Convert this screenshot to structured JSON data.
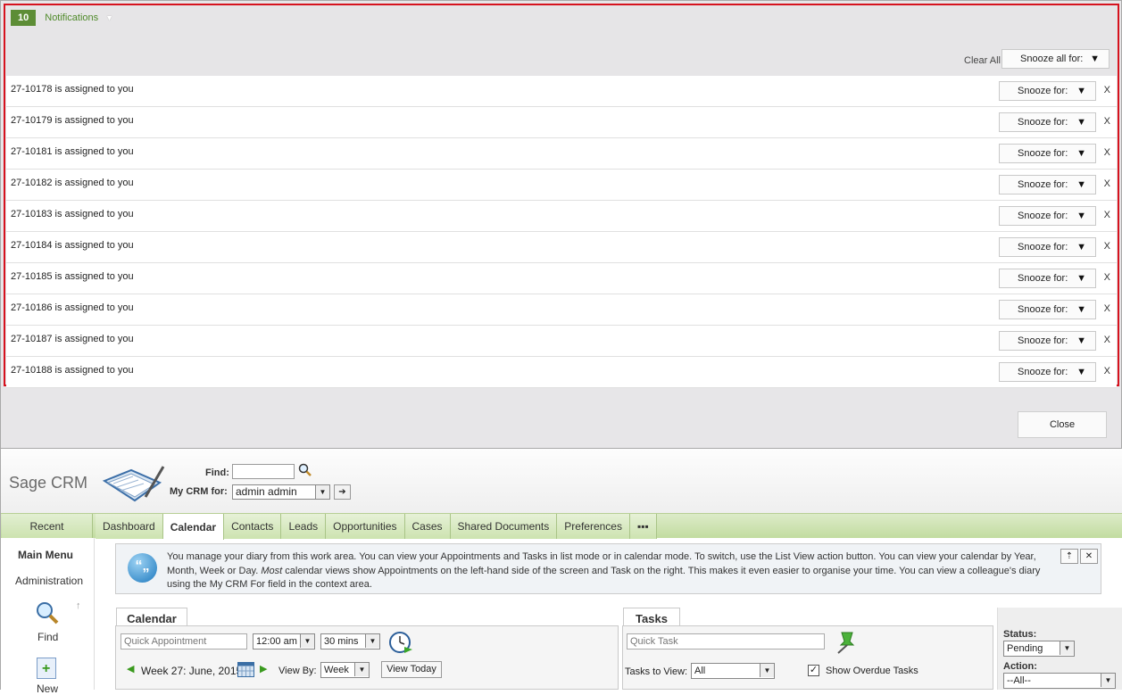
{
  "notifications": {
    "count": "10",
    "title": "Notifications",
    "clear_all": "Clear All",
    "snooze_all": "Snooze all for:",
    "items": [
      {
        "text": "27-10178 is assigned to you",
        "snooze": "Snooze for:",
        "close": "X"
      },
      {
        "text": "27-10179 is assigned to you",
        "snooze": "Snooze for:",
        "close": "X"
      },
      {
        "text": "27-10181 is assigned to you",
        "snooze": "Snooze for:",
        "close": "X"
      },
      {
        "text": "27-10182 is assigned to you",
        "snooze": "Snooze for:",
        "close": "X"
      },
      {
        "text": "27-10183 is assigned to you",
        "snooze": "Snooze for:",
        "close": "X"
      },
      {
        "text": "27-10184 is assigned to you",
        "snooze": "Snooze for:",
        "close": "X"
      },
      {
        "text": "27-10185 is assigned to you",
        "snooze": "Snooze for:",
        "close": "X"
      },
      {
        "text": "27-10186 is assigned to you",
        "snooze": "Snooze for:",
        "close": "X"
      },
      {
        "text": "27-10187 is assigned to you",
        "snooze": "Snooze for:",
        "close": "X"
      },
      {
        "text": "27-10188 is assigned to you",
        "snooze": "Snooze for:",
        "close": "X"
      }
    ],
    "close_button": "Close"
  },
  "crm": {
    "logo": "Sage CRM",
    "find_label": "Find:",
    "mycrm_label": "My CRM for:",
    "mycrm_value": "admin admin",
    "recent": "Recent",
    "tabs": [
      "Dashboard",
      "Calendar",
      "Contacts",
      "Leads",
      "Opportunities",
      "Cases",
      "Shared Documents",
      "Preferences",
      "▪▪▪"
    ],
    "active_tab": "Calendar",
    "left_menu": {
      "main_menu": "Main Menu",
      "administration": "Administration",
      "find": "Find",
      "new": "New"
    },
    "info_text_1": "You manage your diary from this work area. You can view your Appointments and Tasks in list mode or in calendar mode. To switch, use the List View action button. You can view your calendar by Year, Month, Week or Day. ",
    "info_text_em": "Most",
    "info_text_2": " calendar views show Appointments on the left-hand side of the screen and Task on the right. This makes it even easier to organise your time. You can view a colleague's diary using the My CRM For field in the context area.",
    "calendar": {
      "tab": "Calendar",
      "quick_appointment_placeholder": "Quick Appointment",
      "time": "12:00 am",
      "duration": "30 mins",
      "week_label": "Week 27: June, 2015",
      "view_by_label": "View By:",
      "view_by_value": "Week",
      "view_today": "View Today"
    },
    "tasks": {
      "tab": "Tasks",
      "quick_task_placeholder": "Quick Task",
      "tasks_to_view_label": "Tasks to View:",
      "tasks_to_view_value": "All",
      "show_overdue": "Show Overdue Tasks",
      "show_overdue_checked": true
    },
    "side": {
      "status_label": "Status:",
      "status_value": "Pending",
      "action_label": "Action:",
      "action_value": "--All--"
    }
  }
}
